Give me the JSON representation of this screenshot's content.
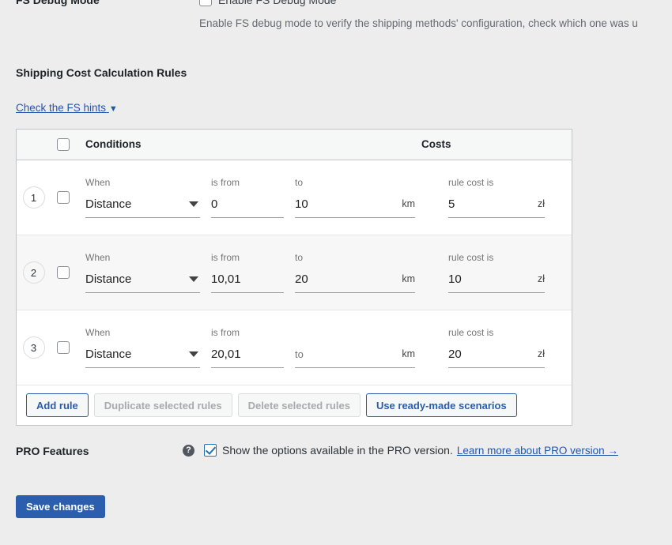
{
  "debug": {
    "label": "FS Debug Mode",
    "checkbox_label": "Enable FS Debug Mode",
    "checked": false,
    "description": "Enable FS debug mode to verify the shipping methods' configuration, check which one was u"
  },
  "section": {
    "title": "Shipping Cost Calculation Rules",
    "hints_link": "Check the FS hints",
    "hints_caret": "▼"
  },
  "table": {
    "headers": {
      "conditions": "Conditions",
      "costs": "Costs"
    },
    "select_all_checked": false,
    "rows": [
      {
        "number": "1",
        "selected": false,
        "when_label": "When",
        "when_value": "Distance",
        "from_label": "is from",
        "from_value": "0",
        "to_label": "to",
        "to_value": "10",
        "distance_unit": "km",
        "cost_label": "rule cost is",
        "cost_value": "5",
        "currency": "zł"
      },
      {
        "number": "2",
        "selected": false,
        "when_label": "When",
        "when_value": "Distance",
        "from_label": "is from",
        "from_value": "10,01",
        "to_label": "to",
        "to_value": "20",
        "distance_unit": "km",
        "cost_label": "rule cost is",
        "cost_value": "10",
        "currency": "zł"
      },
      {
        "number": "3",
        "selected": false,
        "when_label": "When",
        "when_value": "Distance",
        "from_label": "is from",
        "from_value": "20,01",
        "to_label": "to",
        "to_value": "",
        "distance_unit": "km",
        "cost_label": "rule cost is",
        "cost_value": "20",
        "currency": "zł"
      }
    ],
    "actions": [
      {
        "label": "Add rule",
        "state": "enabled"
      },
      {
        "label": "Duplicate selected rules",
        "state": "disabled"
      },
      {
        "label": "Delete selected rules",
        "state": "disabled"
      },
      {
        "label": "Use ready-made scenarios",
        "state": "enabled"
      }
    ]
  },
  "pro": {
    "label": "PRO Features",
    "help_icon": "?",
    "checked": true,
    "text": "Show the options available in the PRO version.",
    "link": "Learn more about PRO version →"
  },
  "save": {
    "label": "Save changes"
  },
  "colors": {
    "page_bg": "#ededed",
    "accent_blue": "#2b5fad",
    "link_blue": "#2255aa",
    "row_alt_bg": "#f7f7f7",
    "header_bg": "#f6f7f7",
    "border": "#c3c4c7"
  }
}
